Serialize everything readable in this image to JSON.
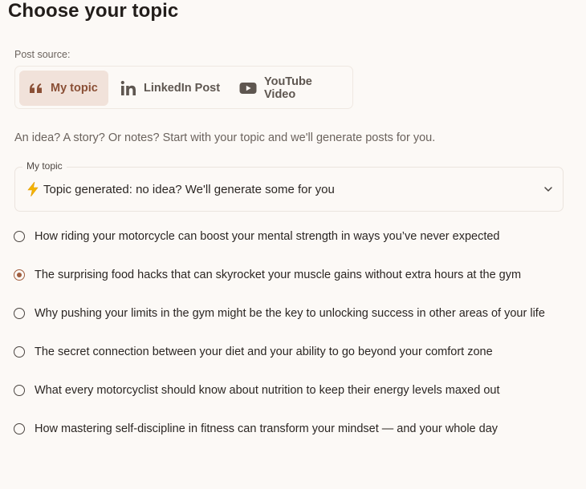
{
  "page": {
    "title": "Choose your topic"
  },
  "source": {
    "label": "Post source:",
    "tabs": [
      {
        "label": "My topic",
        "icon": "quote-icon",
        "selected": true
      },
      {
        "label": "LinkedIn Post",
        "icon": "linkedin-icon",
        "selected": false
      },
      {
        "label": "YouTube Video",
        "icon": "youtube-icon",
        "selected": false
      }
    ]
  },
  "description": "An idea? A story? Or notes? Start with your topic and we'll generate posts for you.",
  "topic_field": {
    "label": "My topic",
    "value": "Topic generated: no idea? We'll generate some for you",
    "icon": "lightning-icon"
  },
  "options": [
    {
      "text": "How riding your motorcycle can boost your mental strength in ways you’ve never expected",
      "selected": false
    },
    {
      "text": "The surprising food hacks that can skyrocket your muscle gains without extra hours at the gym",
      "selected": true
    },
    {
      "text": "Why pushing your limits in the gym might be the key to unlocking success in other areas of your life",
      "selected": false
    },
    {
      "text": "The secret connection between your diet and your ability to go beyond your comfort zone",
      "selected": false
    },
    {
      "text": "What every motorcyclist should know about nutrition to keep their energy levels maxed out",
      "selected": false
    },
    {
      "text": "How mastering self-discipline in fitness can transform your mindset — and your whole day",
      "selected": false
    }
  ],
  "colors": {
    "background": "#fcf9f6",
    "accent": "#a05d3e",
    "active_tab_bg": "#f1e2da",
    "lightning": "#f4b400"
  }
}
